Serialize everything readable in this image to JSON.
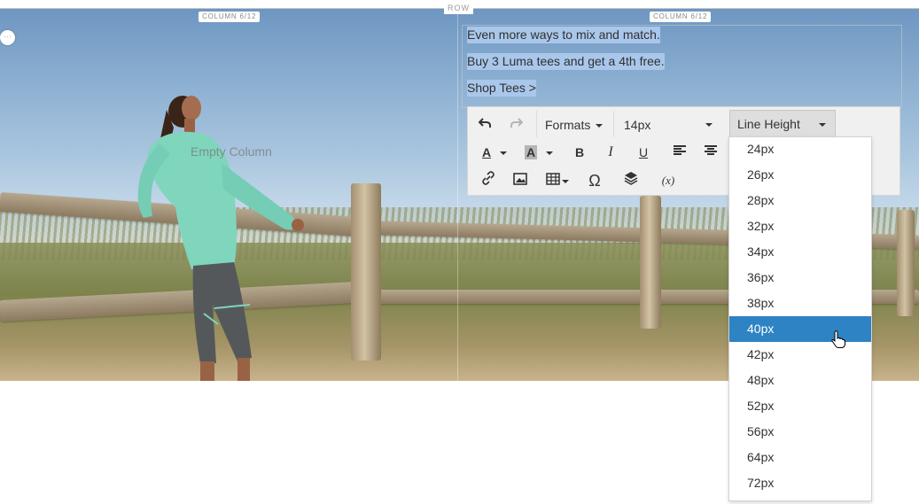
{
  "labels": {
    "row": "ROW",
    "column_left": "COLUMN 6/12",
    "column_right": "COLUMN 6/12",
    "empty_column": "Empty Column",
    "handle": "···"
  },
  "content": {
    "line1": "Even more ways to mix and match.",
    "line2": "Buy 3 Luma tees and get a 4th free.",
    "line3": "Shop Tees >"
  },
  "toolbar": {
    "formats_label": "Formats",
    "font_size_value": "14px",
    "line_height_label": "Line Height",
    "undo_icon": "undo-icon",
    "redo_icon": "redo-icon",
    "bold_label": "B",
    "italic_label": "I",
    "underline_label": "U",
    "omega_label": "Ω",
    "variable_label": "(x)"
  },
  "line_height_options": [
    "24px",
    "26px",
    "28px",
    "32px",
    "34px",
    "36px",
    "38px",
    "40px",
    "42px",
    "48px",
    "52px",
    "56px",
    "64px",
    "72px"
  ],
  "selected_option": "40px",
  "colors": {
    "selection_highlight": "#a9c7ea",
    "option_selected_bg": "#2d83c3",
    "toolbar_bg": "#f0f0f0"
  }
}
